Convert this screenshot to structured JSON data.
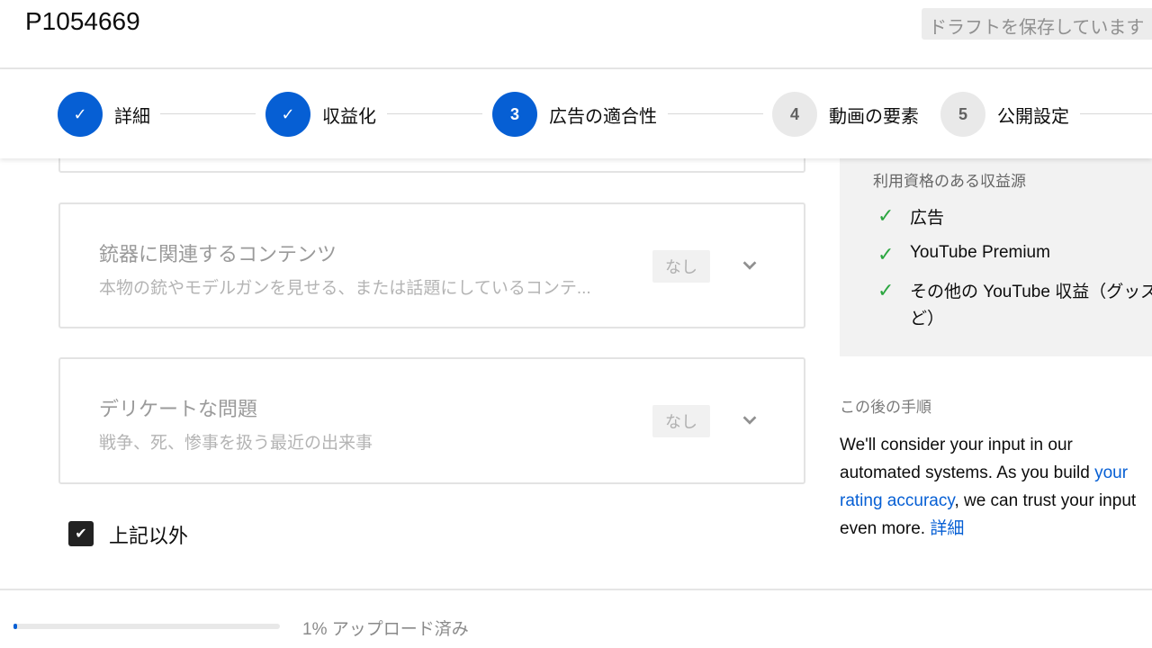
{
  "header": {
    "title": "P1054669",
    "draft_status": "ドラフトを保存しています"
  },
  "stepper": {
    "steps": [
      {
        "label": "詳細",
        "number": "1",
        "state": "done"
      },
      {
        "label": "収益化",
        "number": "2",
        "state": "done"
      },
      {
        "label": "広告の適合性",
        "number": "3",
        "state": "current"
      },
      {
        "label": "動画の要素",
        "number": "4",
        "state": "todo"
      },
      {
        "label": "公開設定",
        "number": "5",
        "state": "todo"
      }
    ]
  },
  "cards": [
    {
      "title": "銃器に関連するコンテンツ",
      "desc": "本物の銃やモデルガンを見せる、または話題にしているコンテ...",
      "badge": "なし"
    },
    {
      "title": "デリケートな問題",
      "desc": "戦争、死、惨事を扱う最近の出来事",
      "badge": "なし"
    }
  ],
  "checkbox": {
    "label": "上記以外",
    "checked": true
  },
  "revenue": {
    "heading": "利用資格のある収益源",
    "items": [
      "広告",
      "YouTube Premium",
      "その他の YouTube 収益（グッズな",
      "ど）"
    ]
  },
  "next_steps": {
    "heading": "この後の手順",
    "line1": "We'll consider your input in our automated systems.",
    "line2_pre": "As you build ",
    "link1": "your rating accuracy",
    "line2_post": ", we can trust",
    "line3": "your input even more. ",
    "link2": "詳細"
  },
  "upload": {
    "progress_percent": 1,
    "label": "1% アップロード済み"
  },
  "colors": {
    "accent": "#065fd4",
    "check_green": "#2ba640"
  }
}
